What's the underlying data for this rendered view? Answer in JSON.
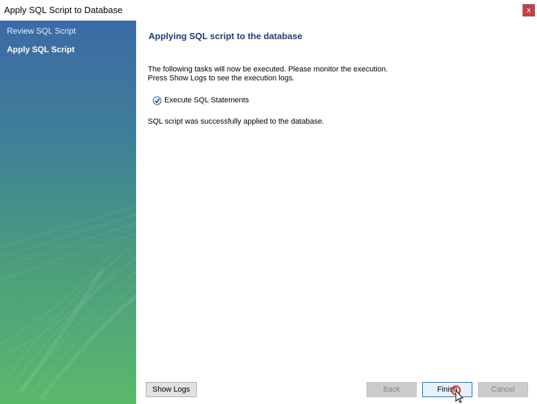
{
  "window": {
    "title": "Apply SQL Script to Database",
    "close_label": "x"
  },
  "sidebar": {
    "items": [
      {
        "label": "Review SQL Script",
        "active": false
      },
      {
        "label": "Apply SQL Script",
        "active": true
      }
    ]
  },
  "main": {
    "title": "Applying SQL script to the database",
    "description_line1": "The following tasks will now be executed. Please monitor the execution.",
    "description_line2": "Press Show Logs to see the execution logs.",
    "tasks": [
      {
        "label": "Execute SQL Statements",
        "status": "done",
        "icon": "check-circle-icon"
      }
    ],
    "result_message": "SQL script was successfully applied to the database."
  },
  "buttons": {
    "show_logs": "Show Logs",
    "back": "Back",
    "finish": "Finish",
    "cancel": "Cancel"
  },
  "colors": {
    "title_text": "#1f3d7a",
    "close_button": "#c2404a",
    "sidebar_top": "#3c6aa6",
    "sidebar_bottom": "#5bb96a",
    "default_button_border": "#0078d7"
  }
}
